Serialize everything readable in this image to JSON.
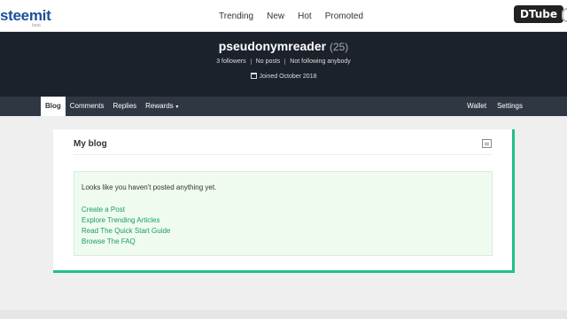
{
  "header": {
    "logo_text": "steemit",
    "logo_beta": "beta",
    "nav": [
      "Trending",
      "New",
      "Hot",
      "Promoted"
    ]
  },
  "overlay": {
    "dtube_label": "DTube"
  },
  "profile": {
    "username": "pseudonymreader",
    "reputation": "(25)",
    "followers": "3 followers",
    "posts": "No posts",
    "following": "Not following anybody",
    "joined": "Joined October 2018"
  },
  "subnav": {
    "left": [
      "Blog",
      "Comments",
      "Replies",
      "Rewards"
    ],
    "right": [
      "Wallet",
      "Settings"
    ],
    "active": "Blog"
  },
  "blog": {
    "title": "My blog",
    "empty_message": "Looks like you haven't posted anything yet.",
    "links": [
      "Create a Post",
      "Explore Trending Articles",
      "Read The Quick Start Guide",
      "Browse The FAQ"
    ]
  },
  "colors": {
    "accent": "#1fbf8f",
    "link": "#1a9c6b",
    "header_bg": "#1c222b",
    "subnav_bg": "#2f3842"
  }
}
